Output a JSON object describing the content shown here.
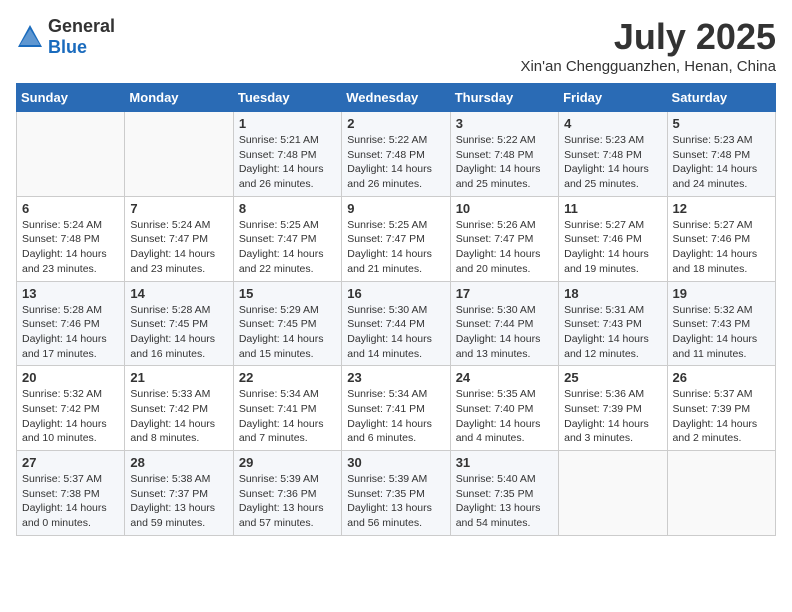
{
  "logo": {
    "general": "General",
    "blue": "Blue"
  },
  "header": {
    "title": "July 2025",
    "subtitle": "Xin'an Chengguanzhen, Henan, China"
  },
  "calendar": {
    "days_of_week": [
      "Sunday",
      "Monday",
      "Tuesday",
      "Wednesday",
      "Thursday",
      "Friday",
      "Saturday"
    ],
    "weeks": [
      [
        {
          "day": "",
          "detail": ""
        },
        {
          "day": "",
          "detail": ""
        },
        {
          "day": "1",
          "detail": "Sunrise: 5:21 AM\nSunset: 7:48 PM\nDaylight: 14 hours and 26 minutes."
        },
        {
          "day": "2",
          "detail": "Sunrise: 5:22 AM\nSunset: 7:48 PM\nDaylight: 14 hours and 26 minutes."
        },
        {
          "day": "3",
          "detail": "Sunrise: 5:22 AM\nSunset: 7:48 PM\nDaylight: 14 hours and 25 minutes."
        },
        {
          "day": "4",
          "detail": "Sunrise: 5:23 AM\nSunset: 7:48 PM\nDaylight: 14 hours and 25 minutes."
        },
        {
          "day": "5",
          "detail": "Sunrise: 5:23 AM\nSunset: 7:48 PM\nDaylight: 14 hours and 24 minutes."
        }
      ],
      [
        {
          "day": "6",
          "detail": "Sunrise: 5:24 AM\nSunset: 7:48 PM\nDaylight: 14 hours and 23 minutes."
        },
        {
          "day": "7",
          "detail": "Sunrise: 5:24 AM\nSunset: 7:47 PM\nDaylight: 14 hours and 23 minutes."
        },
        {
          "day": "8",
          "detail": "Sunrise: 5:25 AM\nSunset: 7:47 PM\nDaylight: 14 hours and 22 minutes."
        },
        {
          "day": "9",
          "detail": "Sunrise: 5:25 AM\nSunset: 7:47 PM\nDaylight: 14 hours and 21 minutes."
        },
        {
          "day": "10",
          "detail": "Sunrise: 5:26 AM\nSunset: 7:47 PM\nDaylight: 14 hours and 20 minutes."
        },
        {
          "day": "11",
          "detail": "Sunrise: 5:27 AM\nSunset: 7:46 PM\nDaylight: 14 hours and 19 minutes."
        },
        {
          "day": "12",
          "detail": "Sunrise: 5:27 AM\nSunset: 7:46 PM\nDaylight: 14 hours and 18 minutes."
        }
      ],
      [
        {
          "day": "13",
          "detail": "Sunrise: 5:28 AM\nSunset: 7:46 PM\nDaylight: 14 hours and 17 minutes."
        },
        {
          "day": "14",
          "detail": "Sunrise: 5:28 AM\nSunset: 7:45 PM\nDaylight: 14 hours and 16 minutes."
        },
        {
          "day": "15",
          "detail": "Sunrise: 5:29 AM\nSunset: 7:45 PM\nDaylight: 14 hours and 15 minutes."
        },
        {
          "day": "16",
          "detail": "Sunrise: 5:30 AM\nSunset: 7:44 PM\nDaylight: 14 hours and 14 minutes."
        },
        {
          "day": "17",
          "detail": "Sunrise: 5:30 AM\nSunset: 7:44 PM\nDaylight: 14 hours and 13 minutes."
        },
        {
          "day": "18",
          "detail": "Sunrise: 5:31 AM\nSunset: 7:43 PM\nDaylight: 14 hours and 12 minutes."
        },
        {
          "day": "19",
          "detail": "Sunrise: 5:32 AM\nSunset: 7:43 PM\nDaylight: 14 hours and 11 minutes."
        }
      ],
      [
        {
          "day": "20",
          "detail": "Sunrise: 5:32 AM\nSunset: 7:42 PM\nDaylight: 14 hours and 10 minutes."
        },
        {
          "day": "21",
          "detail": "Sunrise: 5:33 AM\nSunset: 7:42 PM\nDaylight: 14 hours and 8 minutes."
        },
        {
          "day": "22",
          "detail": "Sunrise: 5:34 AM\nSunset: 7:41 PM\nDaylight: 14 hours and 7 minutes."
        },
        {
          "day": "23",
          "detail": "Sunrise: 5:34 AM\nSunset: 7:41 PM\nDaylight: 14 hours and 6 minutes."
        },
        {
          "day": "24",
          "detail": "Sunrise: 5:35 AM\nSunset: 7:40 PM\nDaylight: 14 hours and 4 minutes."
        },
        {
          "day": "25",
          "detail": "Sunrise: 5:36 AM\nSunset: 7:39 PM\nDaylight: 14 hours and 3 minutes."
        },
        {
          "day": "26",
          "detail": "Sunrise: 5:37 AM\nSunset: 7:39 PM\nDaylight: 14 hours and 2 minutes."
        }
      ],
      [
        {
          "day": "27",
          "detail": "Sunrise: 5:37 AM\nSunset: 7:38 PM\nDaylight: 14 hours and 0 minutes."
        },
        {
          "day": "28",
          "detail": "Sunrise: 5:38 AM\nSunset: 7:37 PM\nDaylight: 13 hours and 59 minutes."
        },
        {
          "day": "29",
          "detail": "Sunrise: 5:39 AM\nSunset: 7:36 PM\nDaylight: 13 hours and 57 minutes."
        },
        {
          "day": "30",
          "detail": "Sunrise: 5:39 AM\nSunset: 7:35 PM\nDaylight: 13 hours and 56 minutes."
        },
        {
          "day": "31",
          "detail": "Sunrise: 5:40 AM\nSunset: 7:35 PM\nDaylight: 13 hours and 54 minutes."
        },
        {
          "day": "",
          "detail": ""
        },
        {
          "day": "",
          "detail": ""
        }
      ]
    ]
  }
}
